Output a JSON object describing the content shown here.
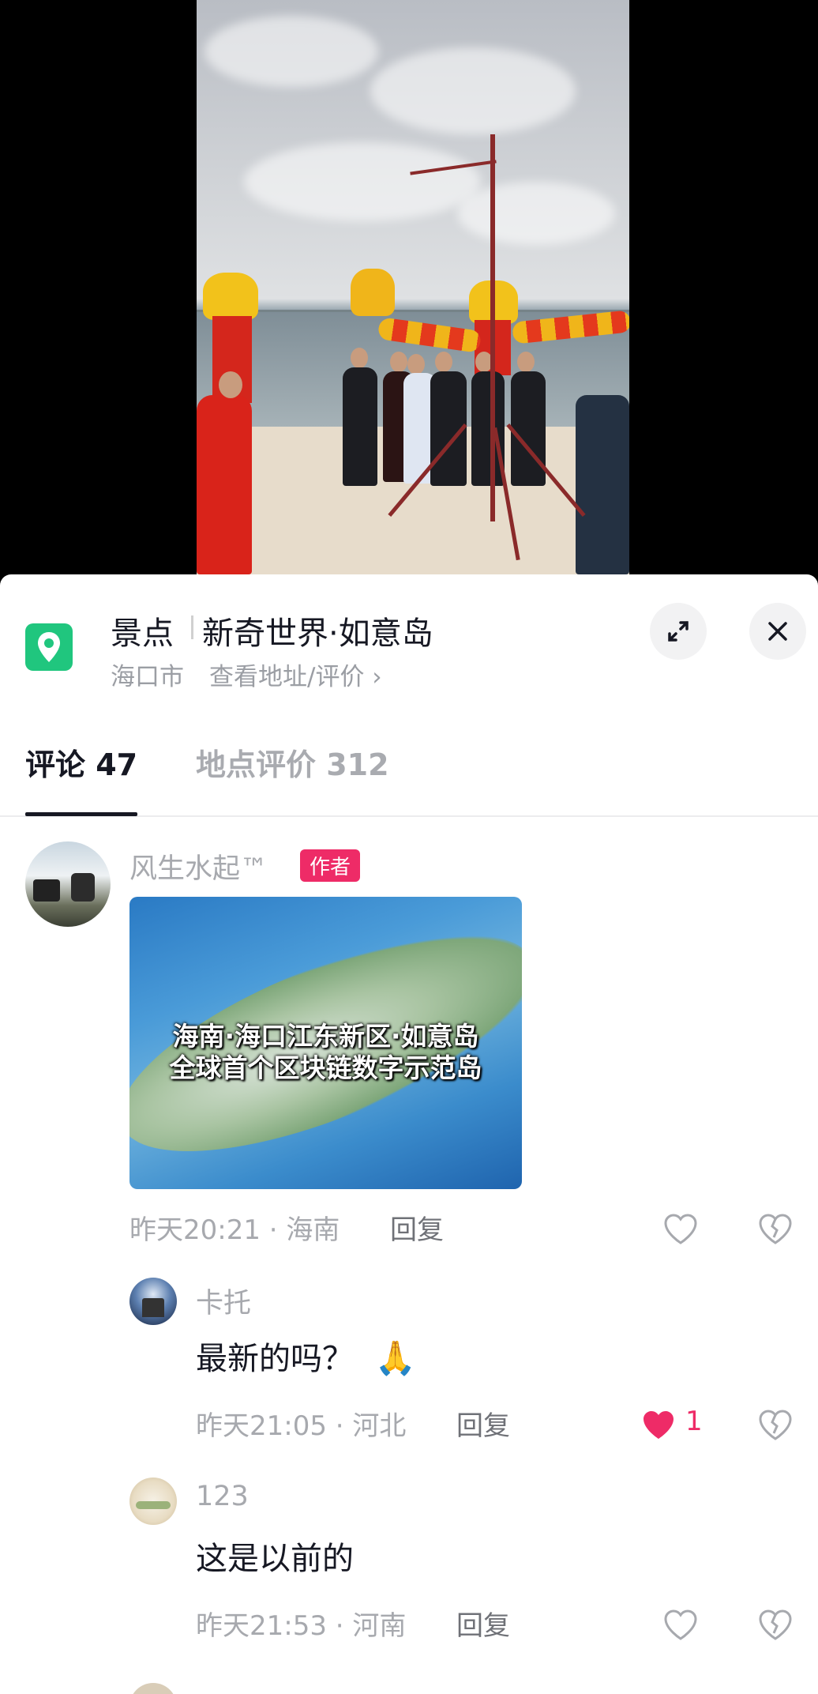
{
  "poi": {
    "category": "景点",
    "name": "新奇世界·如意岛",
    "city": "海口市",
    "link": "查看地址/评价 ›",
    "icons": {
      "pin": "location-pin-icon",
      "expand": "expand-icon",
      "close": "close-icon"
    }
  },
  "tabs": [
    {
      "label": "评论 47",
      "active": true
    },
    {
      "label": "地点评价 312",
      "active": false
    }
  ],
  "comments": [
    {
      "user": "风生水起™",
      "badge": "作者",
      "image_caption_line1": "海南·海口江东新区·如意岛",
      "image_caption_line2": "全球首个区块链数字示范岛",
      "time": "昨天20:21 · 海南",
      "reply": "回复",
      "liked": false
    },
    {
      "user": "卡托",
      "text": "最新的吗？",
      "emoji": "🙏",
      "time": "昨天21:05 · 河北",
      "reply": "回复",
      "liked": true,
      "like_count": "1"
    },
    {
      "user": "123",
      "text": "这是以前的",
      "time": "昨天21:53 · 河南",
      "reply": "回复",
      "liked": false
    }
  ],
  "colors": {
    "accent": "#ee2b67",
    "pin": "#20c67e",
    "text": "#161823",
    "muted": "#a7a9ae"
  }
}
